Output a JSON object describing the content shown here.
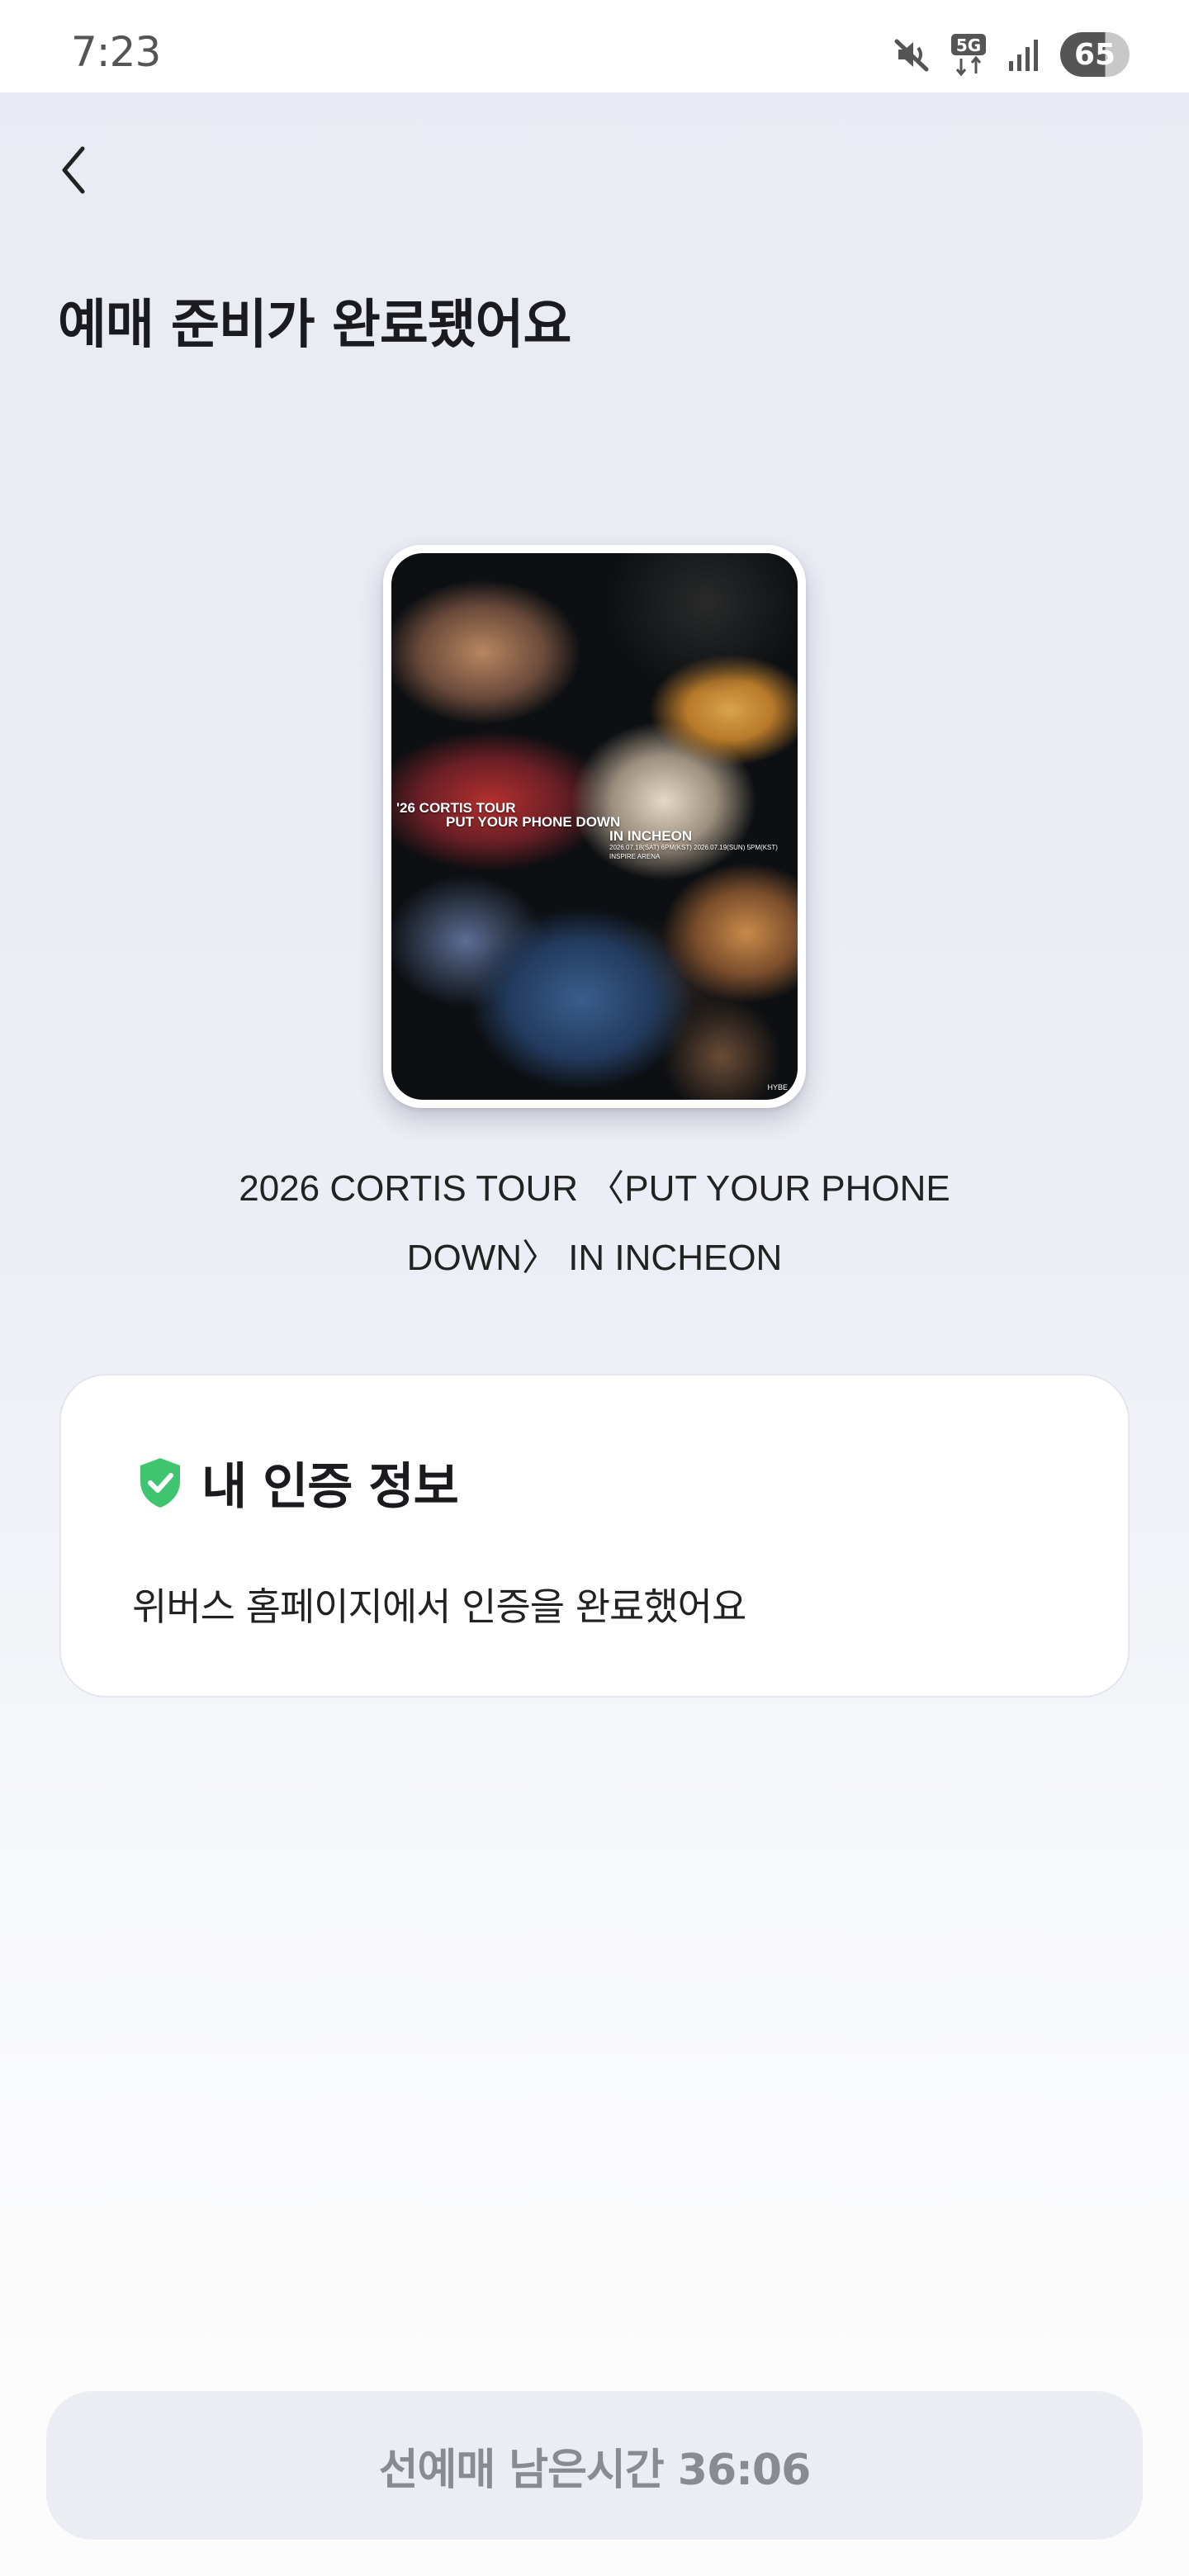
{
  "status_bar": {
    "time": "7:23",
    "network": "5G",
    "battery": "65"
  },
  "page": {
    "title": "예매 준비가 완료됐어요"
  },
  "poster": {
    "line1": "'26 CORTIS TOUR",
    "line2": "PUT YOUR PHONE DOWN",
    "line3": "IN INCHEON",
    "line4": "2026.07.18(SAT) 6PM(KST)   2026.07.19(SUN) 5PM(KST)",
    "line5": "INSPIRE ARENA",
    "logo": "HYBE"
  },
  "event": {
    "title": "2026 CORTIS TOUR 〈PUT YOUR PHONE DOWN〉 IN INCHEON"
  },
  "auth_card": {
    "title": "내 인증 정보",
    "description": "위버스 홈페이지에서 인증을 완료했어요",
    "icon": "shield-check-icon",
    "icon_color": "#3fc56f"
  },
  "presale_button": {
    "label": "선예매 남은시간 36:06"
  }
}
